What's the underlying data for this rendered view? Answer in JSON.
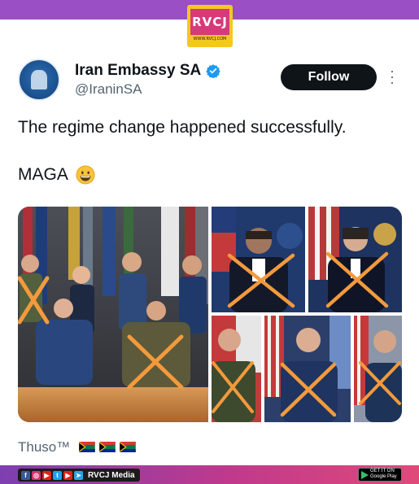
{
  "watermark": {
    "brand": "RVCJ",
    "url": "WWW.RVCJ.COM"
  },
  "account": {
    "display_name": "Iran Embassy SA",
    "handle": "@IraninSA",
    "verified": true,
    "verified_color": "#1d9bf0"
  },
  "follow_label": "Follow",
  "tweet": {
    "text": "The regime change happened successfully.",
    "tag": "MAGA",
    "emoji": "grinning-face"
  },
  "media": {
    "count": 6,
    "overlay_mark": "orange-x",
    "overlay_color": "#f39a3c"
  },
  "reply": {
    "text": "Thuso™",
    "flags": [
      "south-africa-flag",
      "south-africa-flag",
      "south-africa-flag"
    ]
  },
  "footer": {
    "brand": "RVCJ Media",
    "socials": [
      "facebook",
      "instagram",
      "youtube",
      "twitter",
      "youtube",
      "telegram"
    ],
    "store": "Google Play",
    "store_caption": "GET IT ON"
  },
  "colors": {
    "top_bar": "#9b4fc4",
    "follow_bg": "#0f1419",
    "logo_yellow": "#f5c81f",
    "logo_pink": "#d63a7a"
  }
}
